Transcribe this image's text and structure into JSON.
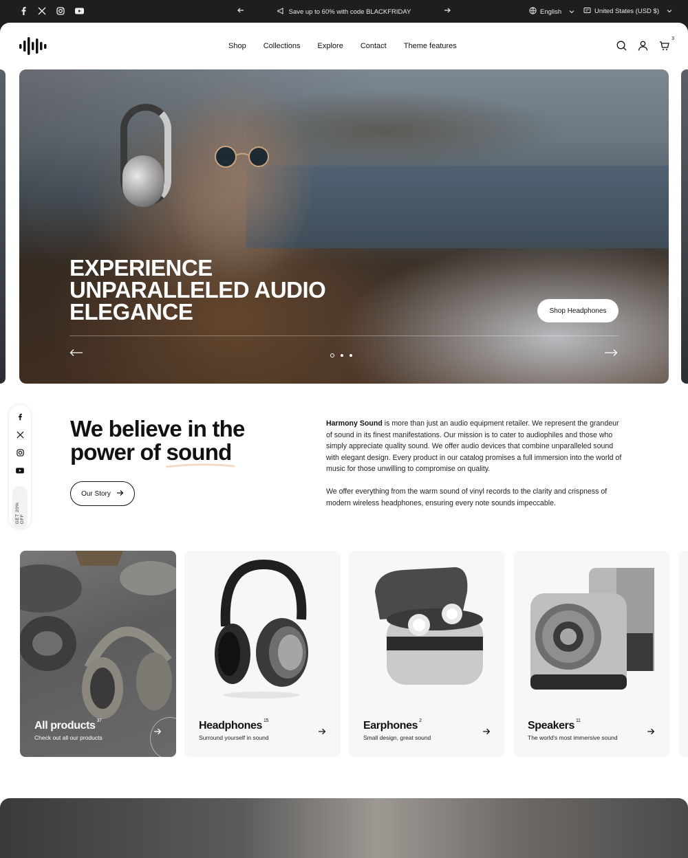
{
  "topbar": {
    "promo": "Save up to 60% with code BLACKFRIDAY",
    "language": "English",
    "currency": "United States (USD $)",
    "socials": [
      "facebook-icon",
      "x-icon",
      "instagram-icon",
      "youtube-icon"
    ]
  },
  "nav": {
    "items": [
      "Shop",
      "Collections",
      "Explore",
      "Contact",
      "Theme features"
    ],
    "cart_count": "3"
  },
  "hero": {
    "title": "EXPERIENCE UNPARALLELED AUDIO ELEGANCE",
    "cta": "Shop Headphones",
    "slide_count": 3,
    "active_slide": 1
  },
  "floater": {
    "pill": "GET 20% OFF"
  },
  "about": {
    "title_line1": "We believe in the",
    "title_line2_prefix": "power of ",
    "title_underlined": "sound",
    "button": "Our Story",
    "brand": "Harmony Sound",
    "p1_rest": " is more than just an audio equipment retailer. We represent the grandeur of sound in its finest manifestations. Our mission is to cater to audiophiles and those who simply appreciate quality sound. We offer audio devices that combine unparalleled sound with elegant design. Every product in our catalog promises a full immersion into the world of music for those unwilling to compromise on quality.",
    "p2": "We offer everything from the warm sound of vinyl records to the clarity and crispness of modern wireless headphones, ensuring every note sounds impeccable."
  },
  "collections": [
    {
      "name": "All products",
      "count": "37",
      "sub": "Check out all our products"
    },
    {
      "name": "Headphones",
      "count": "15",
      "sub": "Surround yourself in sound"
    },
    {
      "name": "Earphones",
      "count": "2",
      "sub": "Small design, great sound"
    },
    {
      "name": "Speakers",
      "count": "11",
      "sub": "The world's most immersive sound"
    }
  ]
}
